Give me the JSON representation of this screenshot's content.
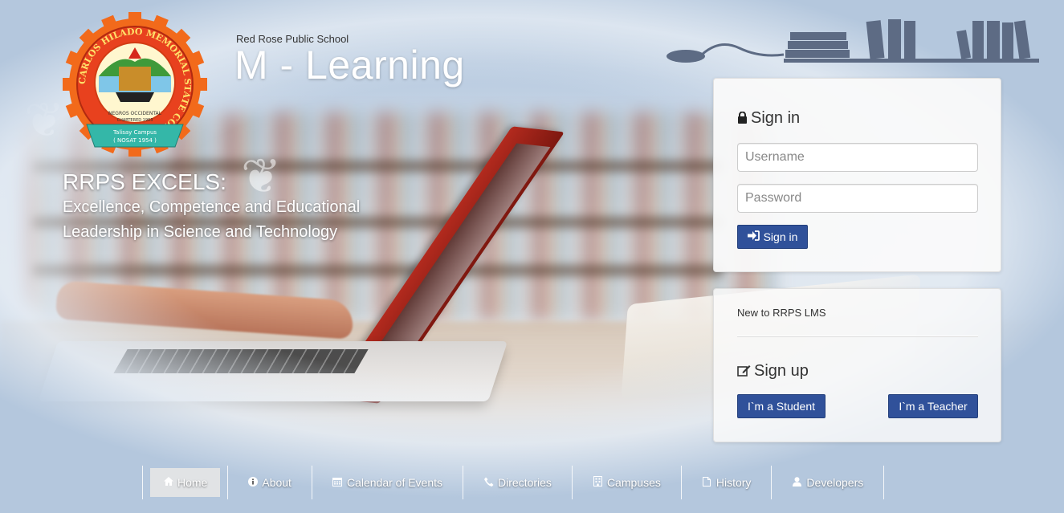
{
  "header": {
    "school_name": "Red Rose Public School",
    "site_title": "M - Learning"
  },
  "logo": {
    "alt": "CARLOS HILADO MEMORIAL STATE COLLEGE seal",
    "ring_text": "CARLOS HILADO MEMORIAL STATE COLLEGE",
    "inner_text": "NEGROS OCCIDENTAL",
    "chartered": "CHARTERED 1983",
    "campus": "Talisay Campus",
    "campus_sub": "( NOSAT 1954 )"
  },
  "motto": {
    "head": "RRPS EXCELS:",
    "line1": "Excellence, Competence and Educational",
    "line2": "Leadership in Science and Technology"
  },
  "signin": {
    "title": "Sign in",
    "username_placeholder": "Username",
    "password_placeholder": "Password",
    "button_label": "Sign in",
    "icon": "lock-icon"
  },
  "signup": {
    "new_to": "New to RRPS LMS",
    "title": "Sign up",
    "student_button": "I`m a Student",
    "teacher_button": "I`m a Teacher",
    "icon": "edit-icon"
  },
  "nav": {
    "items": [
      {
        "label": "Home",
        "icon": "home-icon",
        "active": true
      },
      {
        "label": "About",
        "icon": "info-icon"
      },
      {
        "label": "Calendar of Events",
        "icon": "calendar-icon"
      },
      {
        "label": "Directories",
        "icon": "phone-icon"
      },
      {
        "label": "Campuses",
        "icon": "building-icon"
      },
      {
        "label": "History",
        "icon": "file-icon"
      },
      {
        "label": "Developers",
        "icon": "user-icon"
      }
    ]
  },
  "colors": {
    "primary_button": "#30519a",
    "title_text": "#ffffff",
    "background": "#b9c9dc"
  }
}
